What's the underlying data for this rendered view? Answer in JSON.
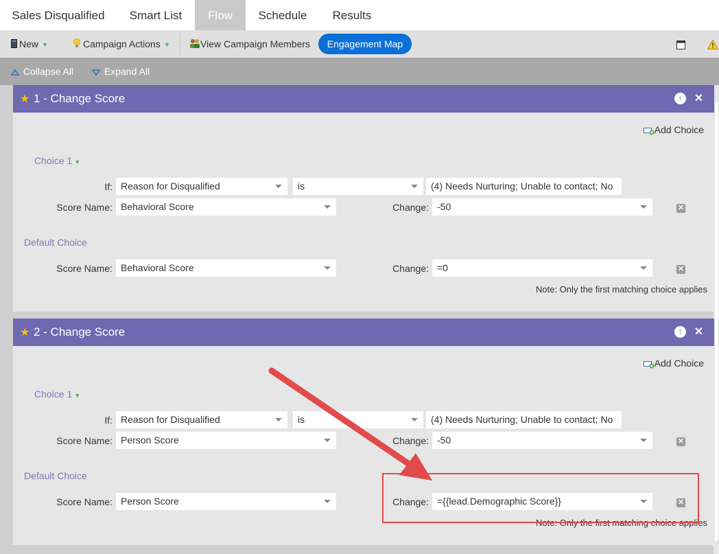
{
  "tabs": [
    {
      "label": "Sales Disqualified"
    },
    {
      "label": "Smart List"
    },
    {
      "label": "Flow"
    },
    {
      "label": "Schedule"
    },
    {
      "label": "Results"
    }
  ],
  "toolbar": {
    "new_label": "New",
    "campaign_actions_label": "Campaign Actions",
    "view_members_label": "View Campaign Members",
    "engagement_map_label": "Engagement Map",
    "icons": [
      "document-icon",
      "lightbulb-icon",
      "people-icon",
      "window-icon",
      "warning-icon"
    ]
  },
  "subbar": {
    "collapse_all": "Collapse All",
    "expand_all": "Expand All"
  },
  "steps": [
    {
      "title": "1 - Change Score",
      "add_choice": "Add Choice",
      "choice_label": "Choice 1",
      "if_label": "If:",
      "if_attribute": "Reason for Disqualified",
      "if_operator": "is",
      "if_value": "(4) Needs Nurturing; Unable to contact; No",
      "score_name_label": "Score Name:",
      "score_name": "Behavioral Score",
      "change_label": "Change:",
      "change_value": "-50",
      "default_choice_label": "Default Choice",
      "default_score_name": "Behavioral Score",
      "default_change_value": "=0",
      "note": "Note: Only the first matching choice applies"
    },
    {
      "title": "2 - Change Score",
      "add_choice": "Add Choice",
      "choice_label": "Choice 1",
      "if_label": "If:",
      "if_attribute": "Reason for Disqualified",
      "if_operator": "is",
      "if_value": "(4) Needs Nurturing; Unable to contact; No",
      "score_name_label": "Score Name:",
      "score_name": "Person Score",
      "change_label": "Change:",
      "change_value": "-50",
      "default_choice_label": "Default Choice",
      "default_score_name": "Person Score",
      "default_change_value": "={{lead.Demographic Score}}",
      "note": "Note: Only the first matching choice applies"
    }
  ],
  "colors": {
    "step_header": "#7068b0",
    "active_tab": "#c9c9c9",
    "engagement_button": "#0a6fd6",
    "annotation_red": "#e14b4b"
  }
}
